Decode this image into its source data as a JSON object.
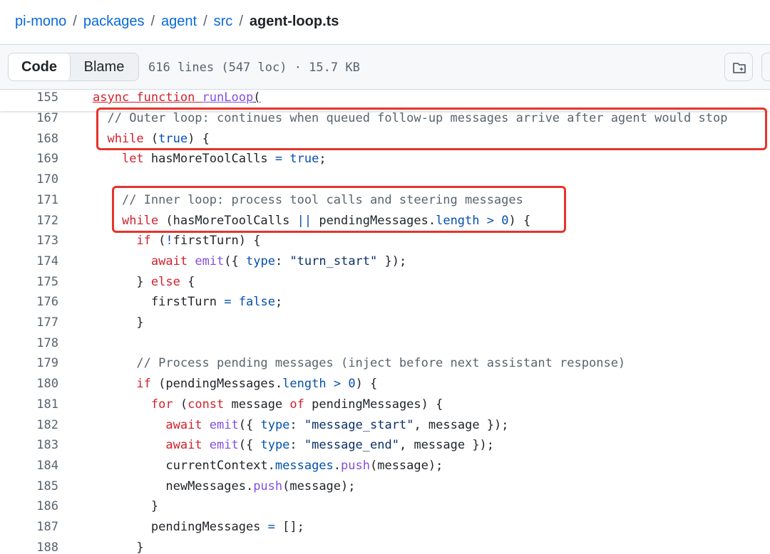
{
  "breadcrumb": {
    "items": [
      "pi-mono",
      "packages",
      "agent",
      "src"
    ],
    "current": "agent-loop.ts",
    "separator": "/"
  },
  "file_header": {
    "code_tab": "Code",
    "blame_tab": "Blame",
    "info": "616 lines (547 loc) · 15.7 KB",
    "actions": [
      "copilot-icon",
      "more-icon"
    ]
  },
  "code": {
    "sticky": {
      "number": "155",
      "tokens": [
        [
          "k",
          "async "
        ],
        [
          "k",
          "function "
        ],
        [
          "f",
          "runLoop"
        ],
        [
          "",
          "("
        ]
      ]
    },
    "lines": [
      {
        "number": "167",
        "indent": "  ",
        "tokens": [
          [
            "c",
            "// Outer loop: continues when queued follow-up messages arrive after agent would stop"
          ]
        ]
      },
      {
        "number": "168",
        "indent": "  ",
        "tokens": [
          [
            "k",
            "while"
          ],
          [
            "",
            " ("
          ],
          [
            "b",
            "true"
          ],
          [
            "",
            ") {"
          ]
        ]
      },
      {
        "number": "169",
        "indent": "    ",
        "tokens": [
          [
            "k",
            "let"
          ],
          [
            "",
            " hasMoreToolCalls "
          ],
          [
            "b",
            "="
          ],
          [
            "",
            " "
          ],
          [
            "b",
            "true"
          ],
          [
            "",
            ";"
          ]
        ]
      },
      {
        "number": "170",
        "indent": "",
        "tokens": []
      },
      {
        "number": "171",
        "indent": "    ",
        "tokens": [
          [
            "c",
            "// Inner loop: process tool calls and steering messages"
          ]
        ]
      },
      {
        "number": "172",
        "indent": "    ",
        "tokens": [
          [
            "k",
            "while"
          ],
          [
            "",
            " (hasMoreToolCalls "
          ],
          [
            "b",
            "||"
          ],
          [
            "",
            " pendingMessages."
          ],
          [
            "b",
            "length"
          ],
          [
            "",
            " "
          ],
          [
            "b",
            ">"
          ],
          [
            "",
            " "
          ],
          [
            "b",
            "0"
          ],
          [
            "",
            ") {"
          ]
        ]
      },
      {
        "number": "173",
        "indent": "      ",
        "tokens": [
          [
            "k",
            "if"
          ],
          [
            "",
            " ("
          ],
          [
            "b",
            "!"
          ],
          [
            "",
            "firstTurn) {"
          ]
        ]
      },
      {
        "number": "174",
        "indent": "        ",
        "tokens": [
          [
            "k",
            "await"
          ],
          [
            "",
            " "
          ],
          [
            "f",
            "emit"
          ],
          [
            "",
            "({ "
          ],
          [
            "b",
            "type"
          ],
          [
            "",
            ": "
          ],
          [
            "s",
            "\"turn_start\""
          ],
          [
            "",
            " });"
          ]
        ]
      },
      {
        "number": "175",
        "indent": "      ",
        "tokens": [
          [
            "",
            "} "
          ],
          [
            "k",
            "else"
          ],
          [
            "",
            " {"
          ]
        ]
      },
      {
        "number": "176",
        "indent": "        ",
        "tokens": [
          [
            "",
            "firstTurn "
          ],
          [
            "b",
            "="
          ],
          [
            "",
            " "
          ],
          [
            "b",
            "false"
          ],
          [
            "",
            ";"
          ]
        ]
      },
      {
        "number": "177",
        "indent": "      ",
        "tokens": [
          [
            "",
            "}"
          ]
        ]
      },
      {
        "number": "178",
        "indent": "",
        "tokens": []
      },
      {
        "number": "179",
        "indent": "      ",
        "tokens": [
          [
            "c",
            "// Process pending messages (inject before next assistant response)"
          ]
        ]
      },
      {
        "number": "180",
        "indent": "      ",
        "tokens": [
          [
            "k",
            "if"
          ],
          [
            "",
            " (pendingMessages."
          ],
          [
            "b",
            "length"
          ],
          [
            "",
            " "
          ],
          [
            "b",
            ">"
          ],
          [
            "",
            " "
          ],
          [
            "b",
            "0"
          ],
          [
            "",
            ") {"
          ]
        ]
      },
      {
        "number": "181",
        "indent": "        ",
        "tokens": [
          [
            "k",
            "for"
          ],
          [
            "",
            " ("
          ],
          [
            "k",
            "const"
          ],
          [
            "",
            " message "
          ],
          [
            "k",
            "of"
          ],
          [
            "",
            " pendingMessages) {"
          ]
        ]
      },
      {
        "number": "182",
        "indent": "          ",
        "tokens": [
          [
            "k",
            "await"
          ],
          [
            "",
            " "
          ],
          [
            "f",
            "emit"
          ],
          [
            "",
            "({ "
          ],
          [
            "b",
            "type"
          ],
          [
            "",
            ": "
          ],
          [
            "s",
            "\"message_start\""
          ],
          [
            "",
            ", message });"
          ]
        ]
      },
      {
        "number": "183",
        "indent": "          ",
        "tokens": [
          [
            "k",
            "await"
          ],
          [
            "",
            " "
          ],
          [
            "f",
            "emit"
          ],
          [
            "",
            "({ "
          ],
          [
            "b",
            "type"
          ],
          [
            "",
            ": "
          ],
          [
            "s",
            "\"message_end\""
          ],
          [
            "",
            ", message });"
          ]
        ]
      },
      {
        "number": "184",
        "indent": "          ",
        "tokens": [
          [
            "",
            "currentContext."
          ],
          [
            "b",
            "messages"
          ],
          [
            "",
            "."
          ],
          [
            "f",
            "push"
          ],
          [
            "",
            "(message);"
          ]
        ]
      },
      {
        "number": "185",
        "indent": "          ",
        "tokens": [
          [
            "",
            "newMessages."
          ],
          [
            "f",
            "push"
          ],
          [
            "",
            "(message);"
          ]
        ]
      },
      {
        "number": "186",
        "indent": "        ",
        "tokens": [
          [
            "",
            "}"
          ]
        ]
      },
      {
        "number": "187",
        "indent": "        ",
        "tokens": [
          [
            "",
            "pendingMessages "
          ],
          [
            "b",
            "="
          ],
          [
            "",
            " [];"
          ]
        ]
      },
      {
        "number": "188",
        "indent": "      ",
        "tokens": [
          [
            "",
            "}"
          ]
        ]
      }
    ]
  },
  "annotations": {
    "box_color": "#e5342a",
    "boxes": [
      "outer-loop",
      "inner-loop"
    ]
  }
}
